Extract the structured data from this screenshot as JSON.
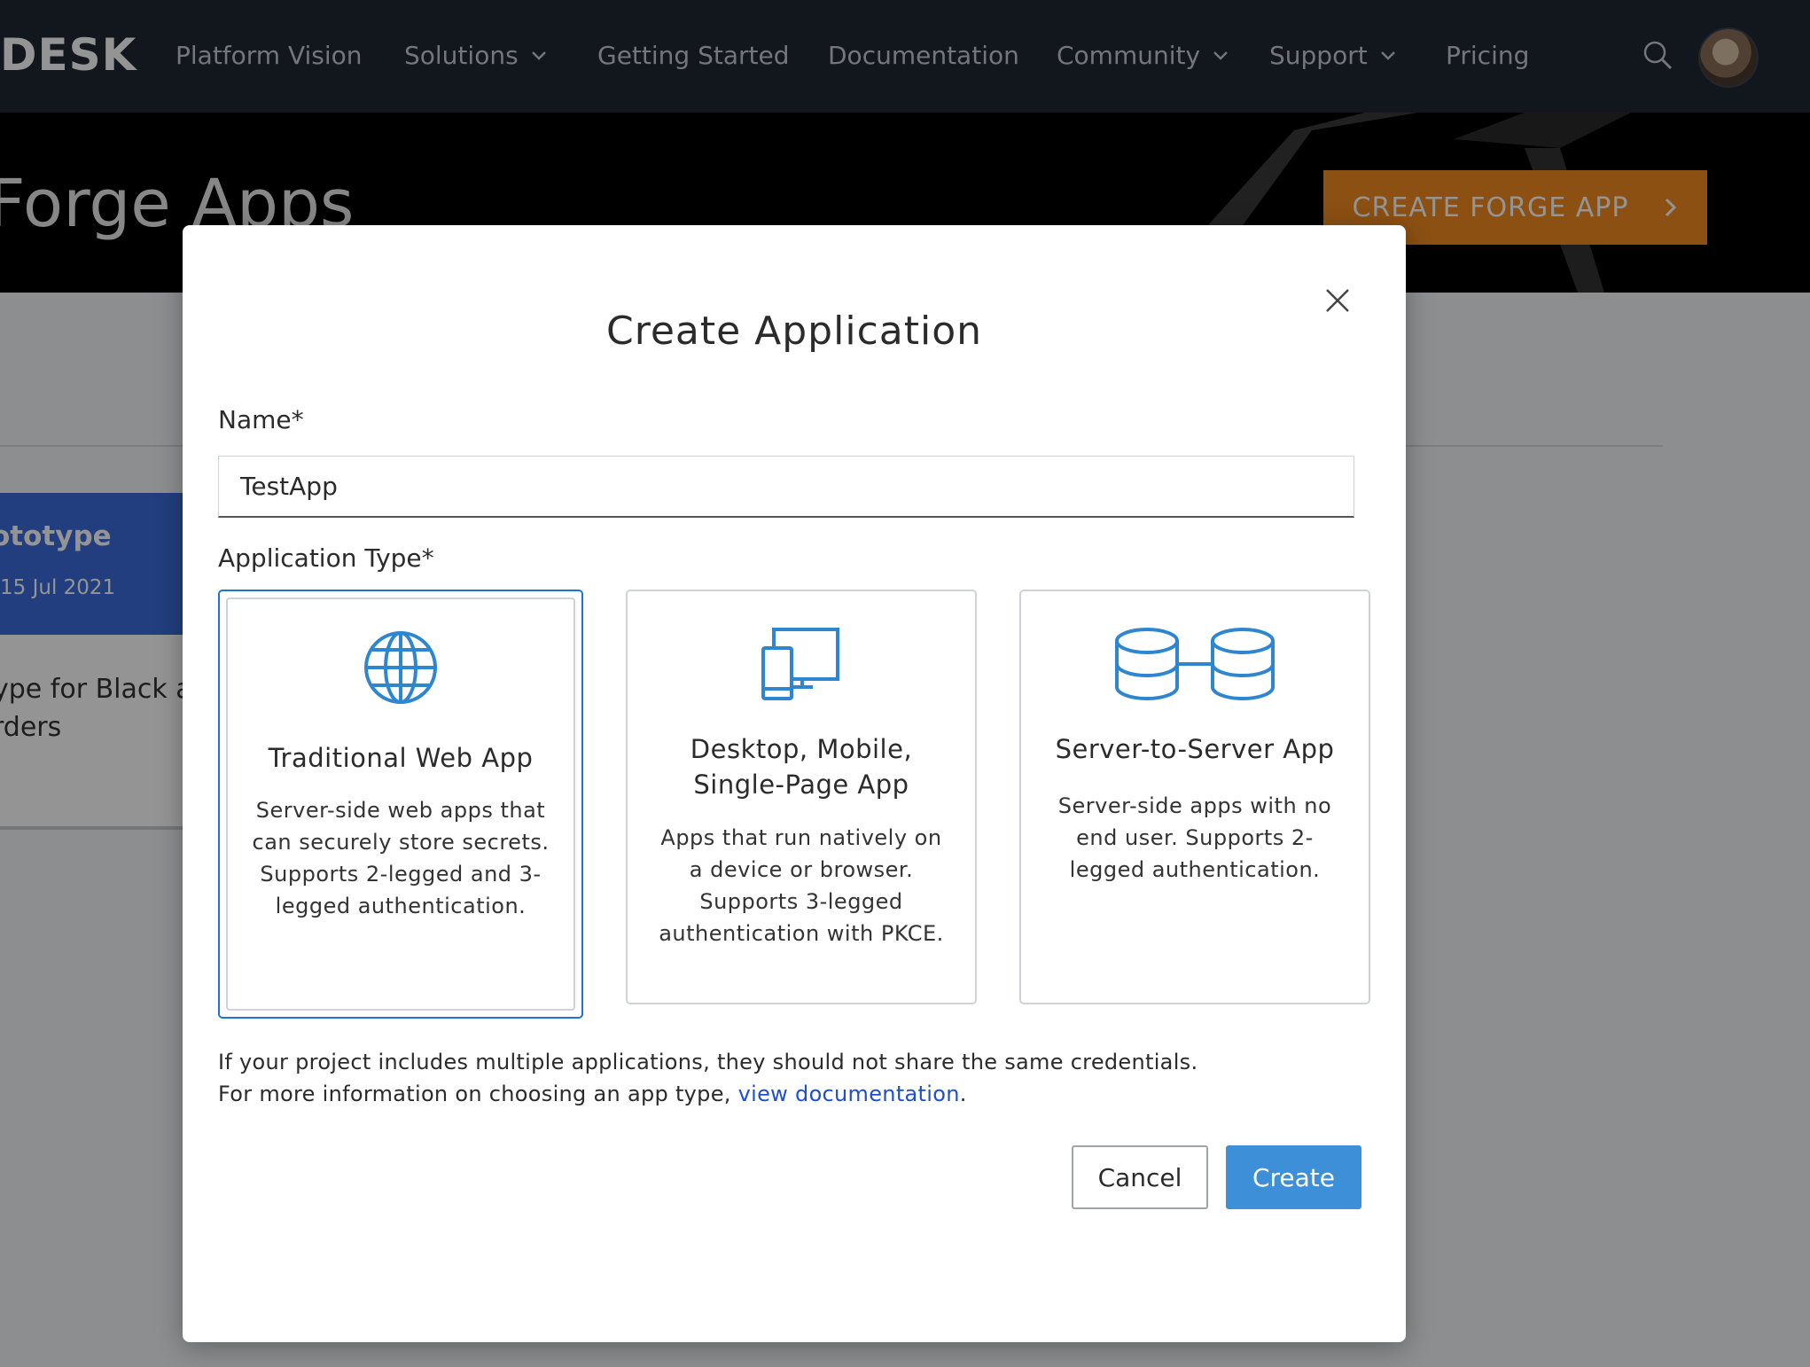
{
  "nav": {
    "logo": "DESK",
    "items": [
      {
        "label": "Platform Vision",
        "has_dropdown": false
      },
      {
        "label": "Solutions",
        "has_dropdown": true
      },
      {
        "label": "Getting Started",
        "has_dropdown": false
      },
      {
        "label": "Documentation",
        "has_dropdown": false
      },
      {
        "label": "Community",
        "has_dropdown": true
      },
      {
        "label": "Support",
        "has_dropdown": true
      },
      {
        "label": "Pricing",
        "has_dropdown": false
      }
    ],
    "search_icon": "search-icon",
    "avatar": "user-avatar"
  },
  "hero": {
    "title": "Forge Apps",
    "create_button": "CREATE FORGE APP"
  },
  "background_card": {
    "title": "ototype",
    "date": "15 Jul 2021",
    "description_line1": "ype for Black a",
    "description_line2": "rders"
  },
  "modal": {
    "title": "Create Application",
    "name_label": "Name*",
    "name_value": "TestApp",
    "type_label": "Application Type*",
    "types": [
      {
        "title": "Traditional Web App",
        "description": "Server-side web apps that can securely store secrets. Supports 2-legged and 3-legged authentication.",
        "icon": "globe-icon",
        "selected": true
      },
      {
        "title": "Desktop, Mobile, Single-Page App",
        "description": "Apps that run natively on a device or browser. Supports 3-legged authentication with PKCE.",
        "icon": "devices-icon",
        "selected": false
      },
      {
        "title": "Server-to-Server App",
        "description": "Server-side apps with no end user. Supports 2-legged authentication.",
        "icon": "database-link-icon",
        "selected": false
      }
    ],
    "info_line1": "If your project includes multiple applications, they should not share the same credentials.",
    "info_line2_prefix": "For more information on choosing an app type, ",
    "info_link": "view documentation",
    "info_line2_suffix": ".",
    "cancel_label": "Cancel",
    "create_label": "Create"
  },
  "colors": {
    "accent_orange": "#f28a1f",
    "primary_blue": "#3d8fd8",
    "selected_border": "#1f73d1",
    "icon_blue": "#2f86d0",
    "nav_bg": "#1f2633"
  }
}
